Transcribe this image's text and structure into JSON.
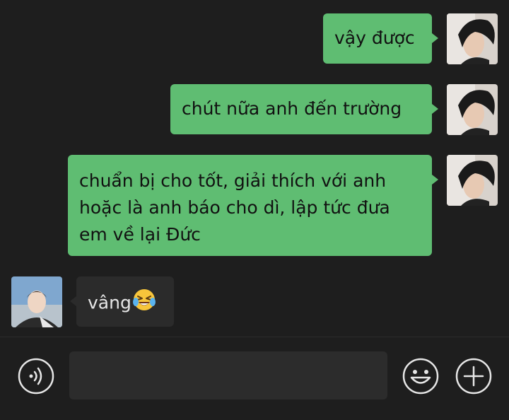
{
  "chat": {
    "messages": [
      {
        "id": "m1",
        "direction": "outgoing",
        "text": "vậy được"
      },
      {
        "id": "m2",
        "direction": "outgoing",
        "text": "chút nữa anh đến trường"
      },
      {
        "id": "m3",
        "direction": "outgoing",
        "lines": [
          "chuẩn bị cho tốt, giải thích với anh",
          "hoặc là anh báo cho dì, lập tức đưa",
          "em về lại Đức"
        ]
      },
      {
        "id": "m4",
        "direction": "incoming",
        "text": "vâng",
        "emoji": "laughing-crying-face"
      }
    ]
  },
  "input_bar": {
    "voice_icon": "voice-icon",
    "emoji_icon": "smiley-icon",
    "add_icon": "plus-icon",
    "message_field_value": ""
  },
  "colors": {
    "background": "#1e1e1e",
    "outgoing_bubble": "#5fbd72",
    "incoming_bubble": "#2b2b2b",
    "input_field": "#2c2c2c"
  }
}
